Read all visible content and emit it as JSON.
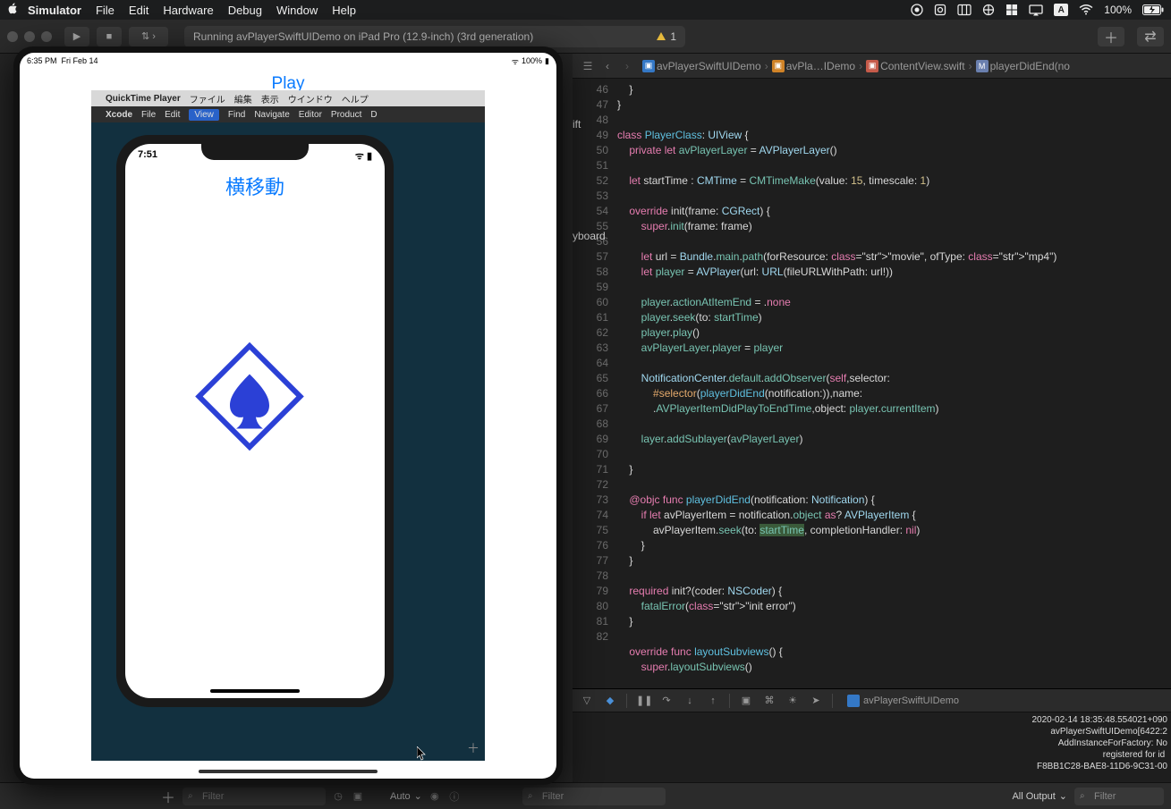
{
  "menubar": {
    "app": "Simulator",
    "items": [
      "File",
      "Edit",
      "Hardware",
      "Debug",
      "Window",
      "Help"
    ],
    "battery_pct": "100%"
  },
  "xcode": {
    "status": "Running avPlayerSwiftUIDemo on iPad Pro (12.9-inch) (3rd generation)",
    "warnings": "1",
    "breadcrumb": {
      "project": "avPlayerSwiftUIDemo",
      "folder": "avPla…IDemo",
      "file": "ContentView.swift",
      "symbol": "playerDidEnd(no"
    },
    "nav_peek_1": "ift",
    "nav_peek_2": "yboard",
    "debug_target": "avPlayerSwiftUIDemo",
    "console_lines": [
      "2020-02-14 18:35:48.554021+090",
      "avPlayerSwiftUIDemo[6422:2",
      "AddInstanceForFactory: No",
      "registered for id <CFUUID",
      "F8BB1C28-BAE8-11D6-9C31-00"
    ],
    "bottom": {
      "auto": "Auto",
      "all_output": "All Output",
      "filter_placeholder": "Filter"
    },
    "code": {
      "first_line": 46,
      "lines": [
        "    }",
        "}",
        "",
        "class PlayerClass: UIView {",
        "    private let avPlayerLayer = AVPlayerLayer()",
        "",
        "    let startTime : CMTime = CMTimeMake(value: 15, timescale: 1)",
        "",
        "    override init(frame: CGRect) {",
        "        super.init(frame: frame)",
        "",
        "        let url = Bundle.main.path(forResource: \"movie\", ofType: \"mp4\")",
        "        let player = AVPlayer(url: URL(fileURLWithPath: url!))",
        "",
        "        player.actionAtItemEnd = .none",
        "        player.seek(to: startTime)",
        "        player.play()",
        "        avPlayerLayer.player = player",
        "",
        "        NotificationCenter.default.addObserver(self,selector:",
        "            #selector(playerDidEnd(notification:)),name:",
        "            .AVPlayerItemDidPlayToEndTime,object: player.currentItem)",
        "",
        "        layer.addSublayer(avPlayerLayer)",
        "",
        "    }",
        "",
        "    @objc func playerDidEnd(notification: Notification) {",
        "        if let avPlayerItem = notification.object as? AVPlayerItem {",
        "            avPlayerItem.seek(to: startTime, completionHandler: nil)",
        "        }",
        "    }",
        "",
        "    required init?(coder: NSCoder) {",
        "        fatalError(\"init error\")",
        "    }",
        "",
        "    override func layoutSubviews() {",
        "        super.layoutSubviews()"
      ]
    }
  },
  "simulator": {
    "status_time": "6:35 PM",
    "status_date": "Fri Feb 14",
    "status_batt": "100%",
    "app_title": "Play",
    "qt_menu": [
      "QuickTime Player",
      "ファイル",
      "編集",
      "表示",
      "ウインドウ",
      "ヘルプ"
    ],
    "xcode_inner_menu": [
      "Xcode",
      "File",
      "Edit",
      "View",
      "Find",
      "Navigate",
      "Editor",
      "Product",
      "D"
    ],
    "inner_phone": {
      "time": "7:51",
      "title": "横移動"
    }
  }
}
